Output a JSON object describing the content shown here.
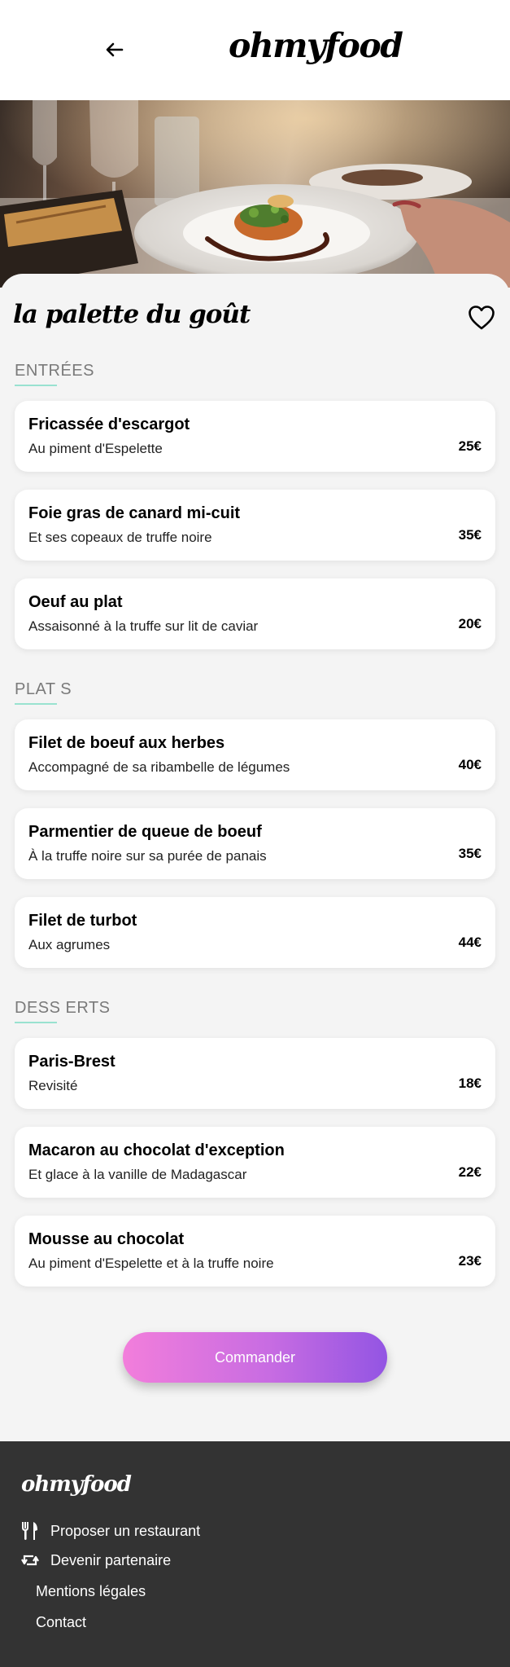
{
  "header": {
    "logo": "ohmyfood",
    "back_icon": "arrow-left-icon"
  },
  "hero": {
    "alt": ""
  },
  "restaurant": {
    "name": "la palette du goût",
    "favorite_icon": "heart-icon"
  },
  "sections": [
    {
      "title": "ENTRÉES",
      "dishes": [
        {
          "name": "Fricassée d'escargot",
          "desc": "Au piment d'Espelette",
          "price": "25€"
        },
        {
          "name": "Foie gras de canard mi-cuit",
          "desc": "Et ses copeaux de truffe noire",
          "price": "35€"
        },
        {
          "name": "Oeuf au plat",
          "desc": "Assaisonné à la truffe sur lit de caviar",
          "price": "20€"
        }
      ]
    },
    {
      "title": "PLAT S",
      "dishes": [
        {
          "name": "Filet de boeuf aux herbes",
          "desc": "Accompagné de sa ribambelle de légumes",
          "price": "40€"
        },
        {
          "name": "Parmentier de queue de boeuf",
          "desc": "À la truffe noire sur sa purée de panais",
          "price": "35€"
        },
        {
          "name": "Filet de turbot",
          "desc": "Aux agrumes",
          "price": "44€"
        }
      ]
    },
    {
      "title": "DESS ERTS",
      "dishes": [
        {
          "name": "Paris-Brest",
          "desc": "Revisité",
          "price": "18€"
        },
        {
          "name": "Macaron au chocolat d'exception",
          "desc": "Et glace à la vanille de Madagascar",
          "price": "22€"
        },
        {
          "name": "Mousse au chocolat",
          "desc": "Au piment d'Espelette et à la truffe noire",
          "price": "23€"
        }
      ]
    }
  ],
  "order_button": "Commander",
  "footer": {
    "logo": "ohmyfood",
    "links": [
      {
        "label": "Proposer un restaurant",
        "icon": "utensils-icon"
      },
      {
        "label": "Devenir partenaire",
        "icon": "retweet-icon"
      },
      {
        "label": "Mentions légales"
      },
      {
        "label": "Contact"
      }
    ]
  },
  "colors": {
    "accent_line": "#99e2d0",
    "button_start": "#f27edb",
    "button_end": "#9355e3",
    "footer_bg": "#333333",
    "page_bg": "#f4f4f4"
  }
}
